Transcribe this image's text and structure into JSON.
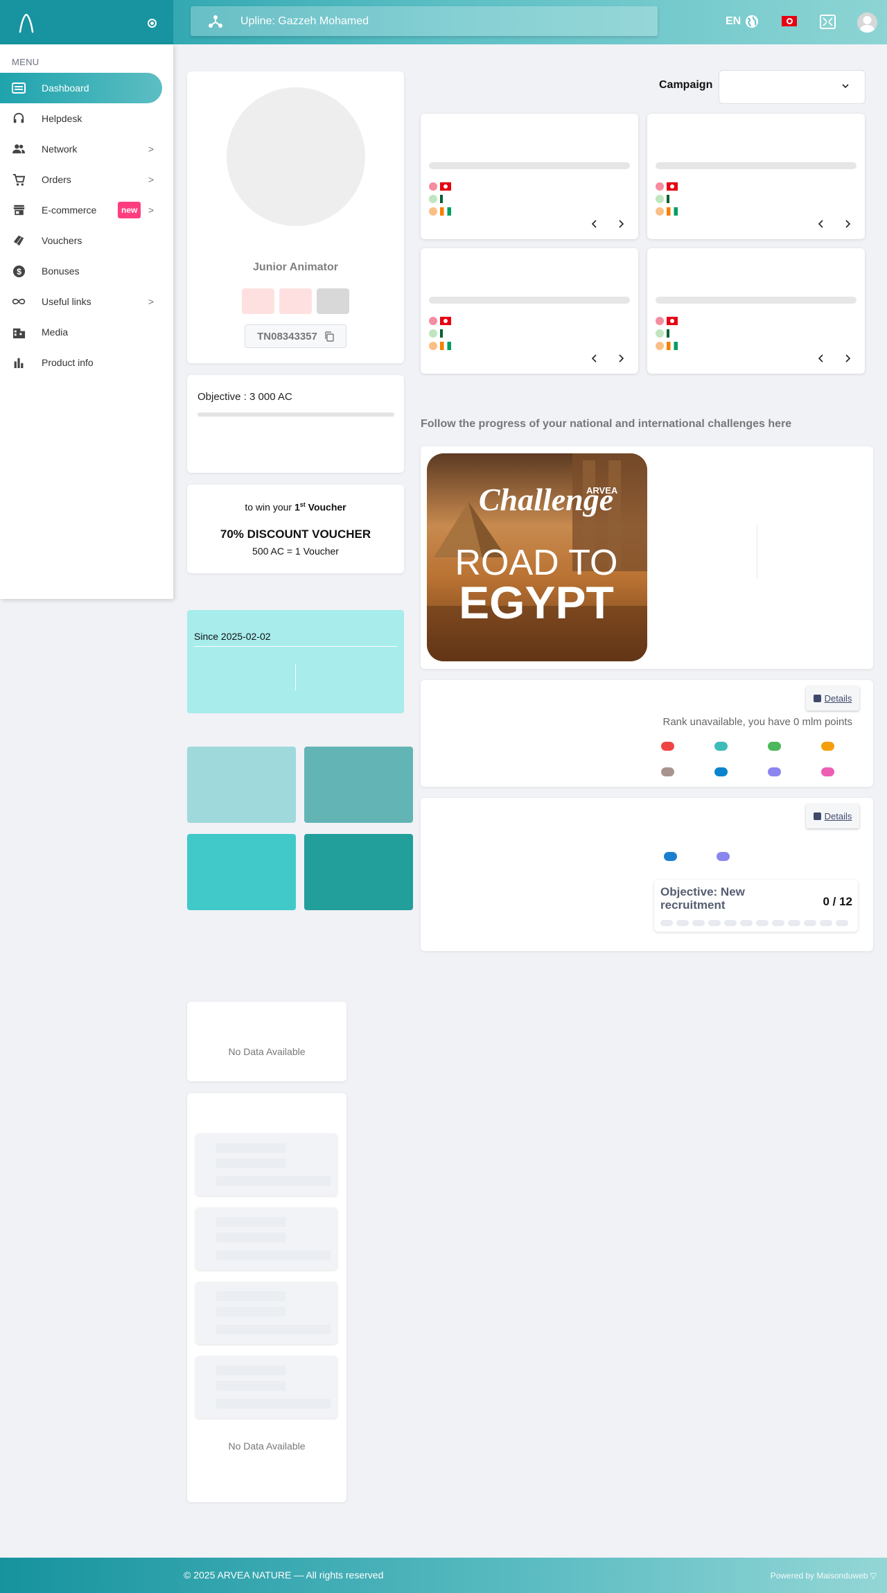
{
  "topbar": {
    "upline_text": "Upline: Gazzeh Mohamed",
    "language": "EN",
    "icons": [
      "brand-logo-icon",
      "radio-dot-icon",
      "network-icon",
      "globe-icon",
      "tunisia-flag-icon",
      "fullscreen-icon",
      "user-avatar-icon"
    ]
  },
  "sidebar": {
    "menu_title": "MENU",
    "items": [
      {
        "label": "Dashboard",
        "icon": "dashboard-icon",
        "active": true
      },
      {
        "label": "Helpdesk",
        "icon": "headset-icon"
      },
      {
        "label": "Network",
        "icon": "people-icon",
        "chevron": ">"
      },
      {
        "label": "Orders",
        "icon": "cart-icon",
        "chevron": ">"
      },
      {
        "label": "E-commerce",
        "icon": "store-icon",
        "badge": "new",
        "chevron": ">"
      },
      {
        "label": "Vouchers",
        "icon": "voucher-icon"
      },
      {
        "label": "Bonuses",
        "icon": "dollar-icon"
      },
      {
        "label": "Useful links",
        "icon": "infinity-icon",
        "chevron": ">"
      },
      {
        "label": "Media",
        "icon": "media-icon"
      },
      {
        "label": "Product info",
        "icon": "bar-chart-icon"
      }
    ]
  },
  "profile": {
    "rank": "Junior Animator",
    "id": "TN08343357"
  },
  "objective": {
    "text": "Objective : 3 000 AC",
    "progress": 0
  },
  "voucher": {
    "line1_pre": "to win your",
    "line1_num": "1",
    "line1_sup": "st",
    "line1_post": "Voucher",
    "title": "70% DISCOUNT VOUCHER",
    "rate": "500 AC = 1 Voucher"
  },
  "since": {
    "text": "Since 2025-02-02"
  },
  "tiles": {
    "colors": [
      "#9fd9dc",
      "#63b5b5",
      "#41c9c9",
      "#229e9b"
    ]
  },
  "panels": {
    "nodata_1": "No Data Available",
    "nodata_2": "No Data Available"
  },
  "campaign": {
    "label": "Campaign",
    "selected": ""
  },
  "challenges": {
    "heading": "Follow the progress of your national and international challenges here",
    "image": {
      "brand": "ARVEA",
      "script": "Challenge",
      "line1": "ROAD TO",
      "line2": "EGYPT"
    }
  },
  "rank": {
    "details_label": "Details",
    "text": "Rank unavailable, you have 0 mlm points",
    "pill_colors": [
      "#ef4444",
      "#3dbdb8",
      "#4cb85c",
      "#f59e0b",
      "#a8948f",
      "#0a84cc",
      "#8b85f0",
      "#ec5fb3"
    ]
  },
  "recruit": {
    "details_label": "Details",
    "title": "Objective: New recruitment",
    "count": "0 / 12",
    "pill_colors": [
      "#1a7fd1",
      "#8b85f0"
    ]
  },
  "footer": {
    "copyright": "© 2025 ARVEA NATURE — All rights reserved",
    "powered": "Powered by Maisonduweb ▽"
  }
}
